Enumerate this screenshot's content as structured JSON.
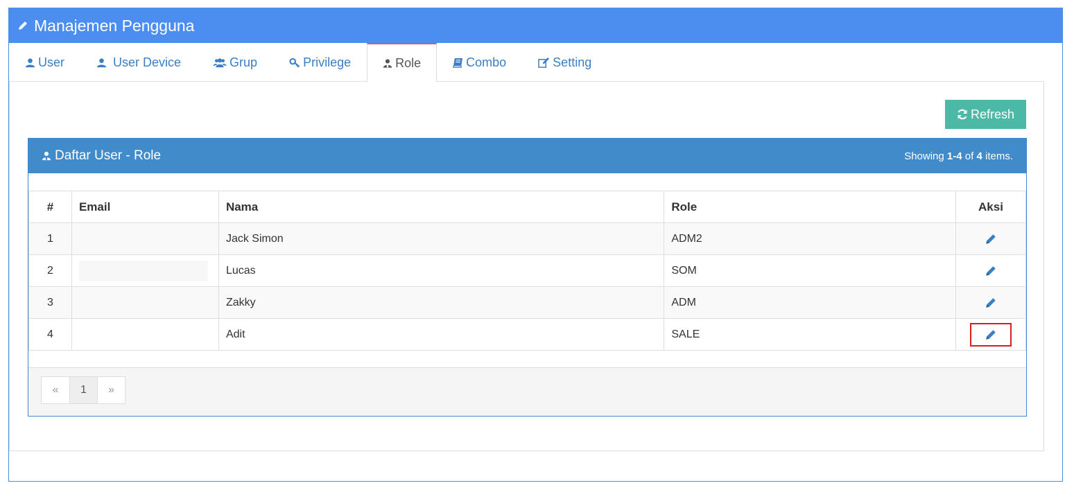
{
  "header": {
    "title": "Manajemen Pengguna",
    "icon": "pencil-icon"
  },
  "tabs": [
    {
      "label": "User",
      "icon": "user-icon",
      "active": false
    },
    {
      "label": "User Device",
      "icon": "user-icon",
      "active": false
    },
    {
      "label": "Grup",
      "icon": "users-icon",
      "active": false
    },
    {
      "label": "Privilege",
      "icon": "key-icon",
      "active": false
    },
    {
      "label": "Role",
      "icon": "user-tie-icon",
      "active": true
    },
    {
      "label": "Combo",
      "icon": "book-icon",
      "active": false
    },
    {
      "label": "Setting",
      "icon": "edit-icon",
      "active": false
    }
  ],
  "toolbar": {
    "refresh_label": "Refresh"
  },
  "grid": {
    "title": "Daftar User - Role",
    "summary_prefix": "Showing",
    "summary_range": "1-4",
    "summary_of": "of",
    "summary_total": "4",
    "summary_suffix": "items.",
    "columns": {
      "no": "#",
      "email": "Email",
      "nama": "Nama",
      "role": "Role",
      "aksi": "Aksi"
    },
    "rows": [
      {
        "no": "1",
        "email": "",
        "nama": "Jack Simon",
        "role": "ADM2"
      },
      {
        "no": "2",
        "email": "",
        "nama": "Lucas",
        "role": "SOM"
      },
      {
        "no": "3",
        "email": "",
        "nama": "Zakky",
        "role": "ADM"
      },
      {
        "no": "4",
        "email": "",
        "nama": "Adit",
        "role": "SALE"
      }
    ]
  },
  "pagination": {
    "prev": "«",
    "current": "1",
    "next": "»"
  },
  "colors": {
    "header_bg": "#4c8ef0",
    "grid_head_bg": "#428bca",
    "refresh_bg": "#4cb8a6",
    "active_tab_border": "#e5565b",
    "link": "#3a7ec4",
    "highlight": "#d61f1f"
  }
}
